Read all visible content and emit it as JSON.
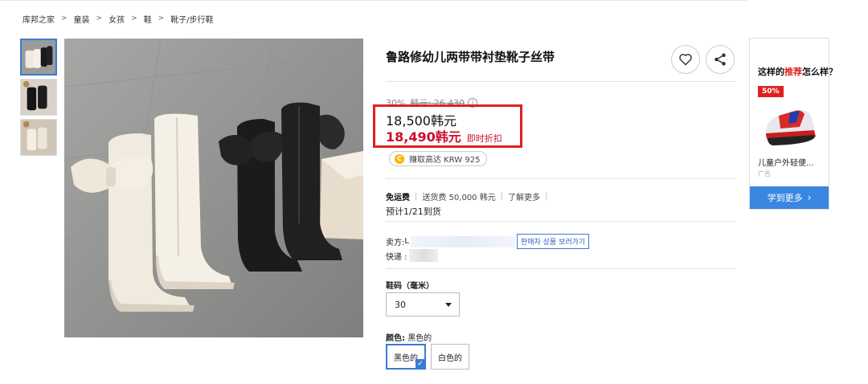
{
  "breadcrumb": [
    "库邦之家",
    "童装",
    "女孩",
    "鞋",
    "靴子/步行鞋"
  ],
  "breadcrumb_separator": ">",
  "product": {
    "title": "鲁路修幼儿两带带衬垫靴子丝带",
    "discount_percent": "30%",
    "original_price": "韩元: 26,430",
    "info_icon": "i",
    "price": "18,500韩元",
    "sale_price": "18,490韩元",
    "sale_tag": "即时折扣",
    "earn_coin": "C",
    "earn_text": "赚取高达 KRW 925"
  },
  "shipping": {
    "free_label": "免运费",
    "fee_note": "送货费 50,000 韩元",
    "learn_more": "了解更多",
    "eta": "预计1/21到货"
  },
  "seller": {
    "label": "卖方:",
    "prefix": "L",
    "link": "판매자 상품 보러가기",
    "express_label": "快递 :"
  },
  "size": {
    "label": "鞋码（毫米）",
    "selected": "30"
  },
  "color": {
    "label_key": "颜色:",
    "label_value": "黑色的",
    "options": [
      "黑色的",
      "白色的"
    ],
    "selected_check": "✓"
  },
  "recommend": {
    "title_pre": "这样的",
    "title_hl": "推荐",
    "title_post": "怎么样？",
    "badge": "50%",
    "item_name": "儿童户外轻便...",
    "ad_label": "广告",
    "more": "学到更多",
    "more_chevron": "›"
  },
  "icons": {
    "heart": "heart-icon",
    "share": "share-icon",
    "dropdown": "caret-down-icon",
    "check": "check-icon"
  },
  "colors": {
    "accent_blue": "#3a7bd5",
    "price_red": "#c8102e",
    "highlight_box": "#e02020",
    "coin": "#f5b800"
  }
}
